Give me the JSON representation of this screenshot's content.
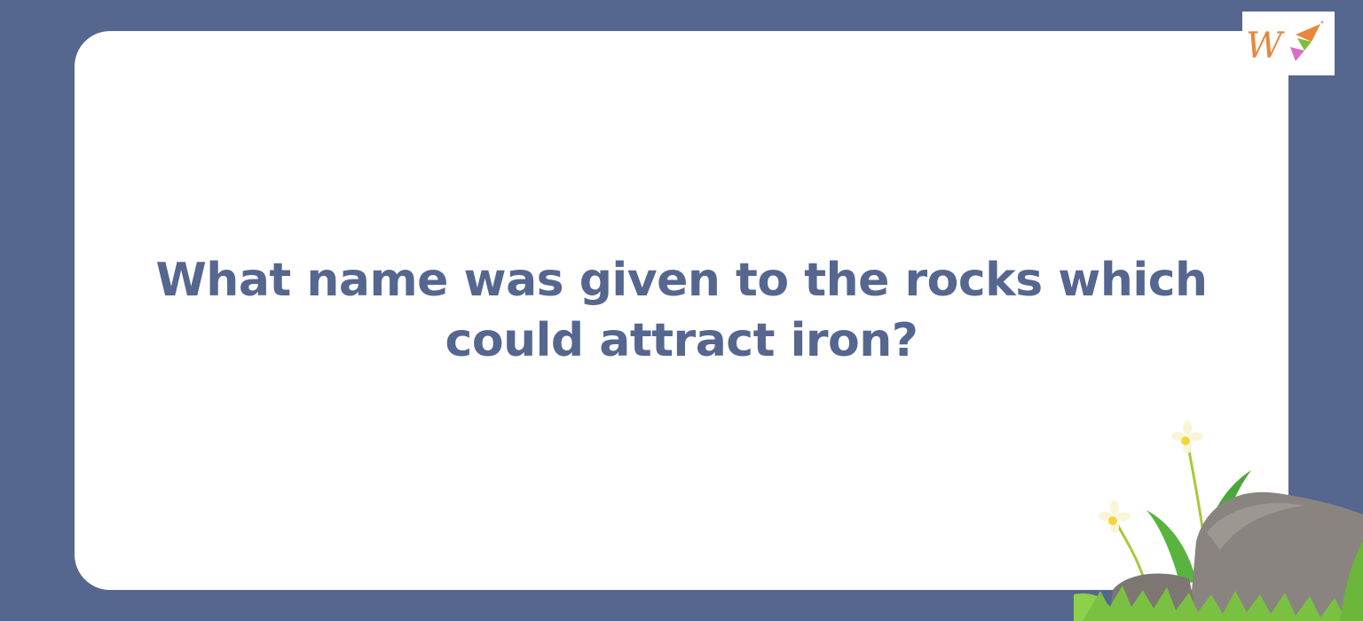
{
  "question": {
    "line1": "What name was given to the rocks which",
    "line2": "could attract iron?"
  },
  "logo": {
    "letter": "W",
    "icon": "brand-logo"
  },
  "colors": {
    "background": "#55668f",
    "card": "#ffffff",
    "text": "#55668f",
    "logo_orange": "#e8873a",
    "logo_pink": "#d96fc4",
    "logo_green": "#7dbd3b",
    "rock": "#8a8480",
    "grass": "#7ac142"
  }
}
